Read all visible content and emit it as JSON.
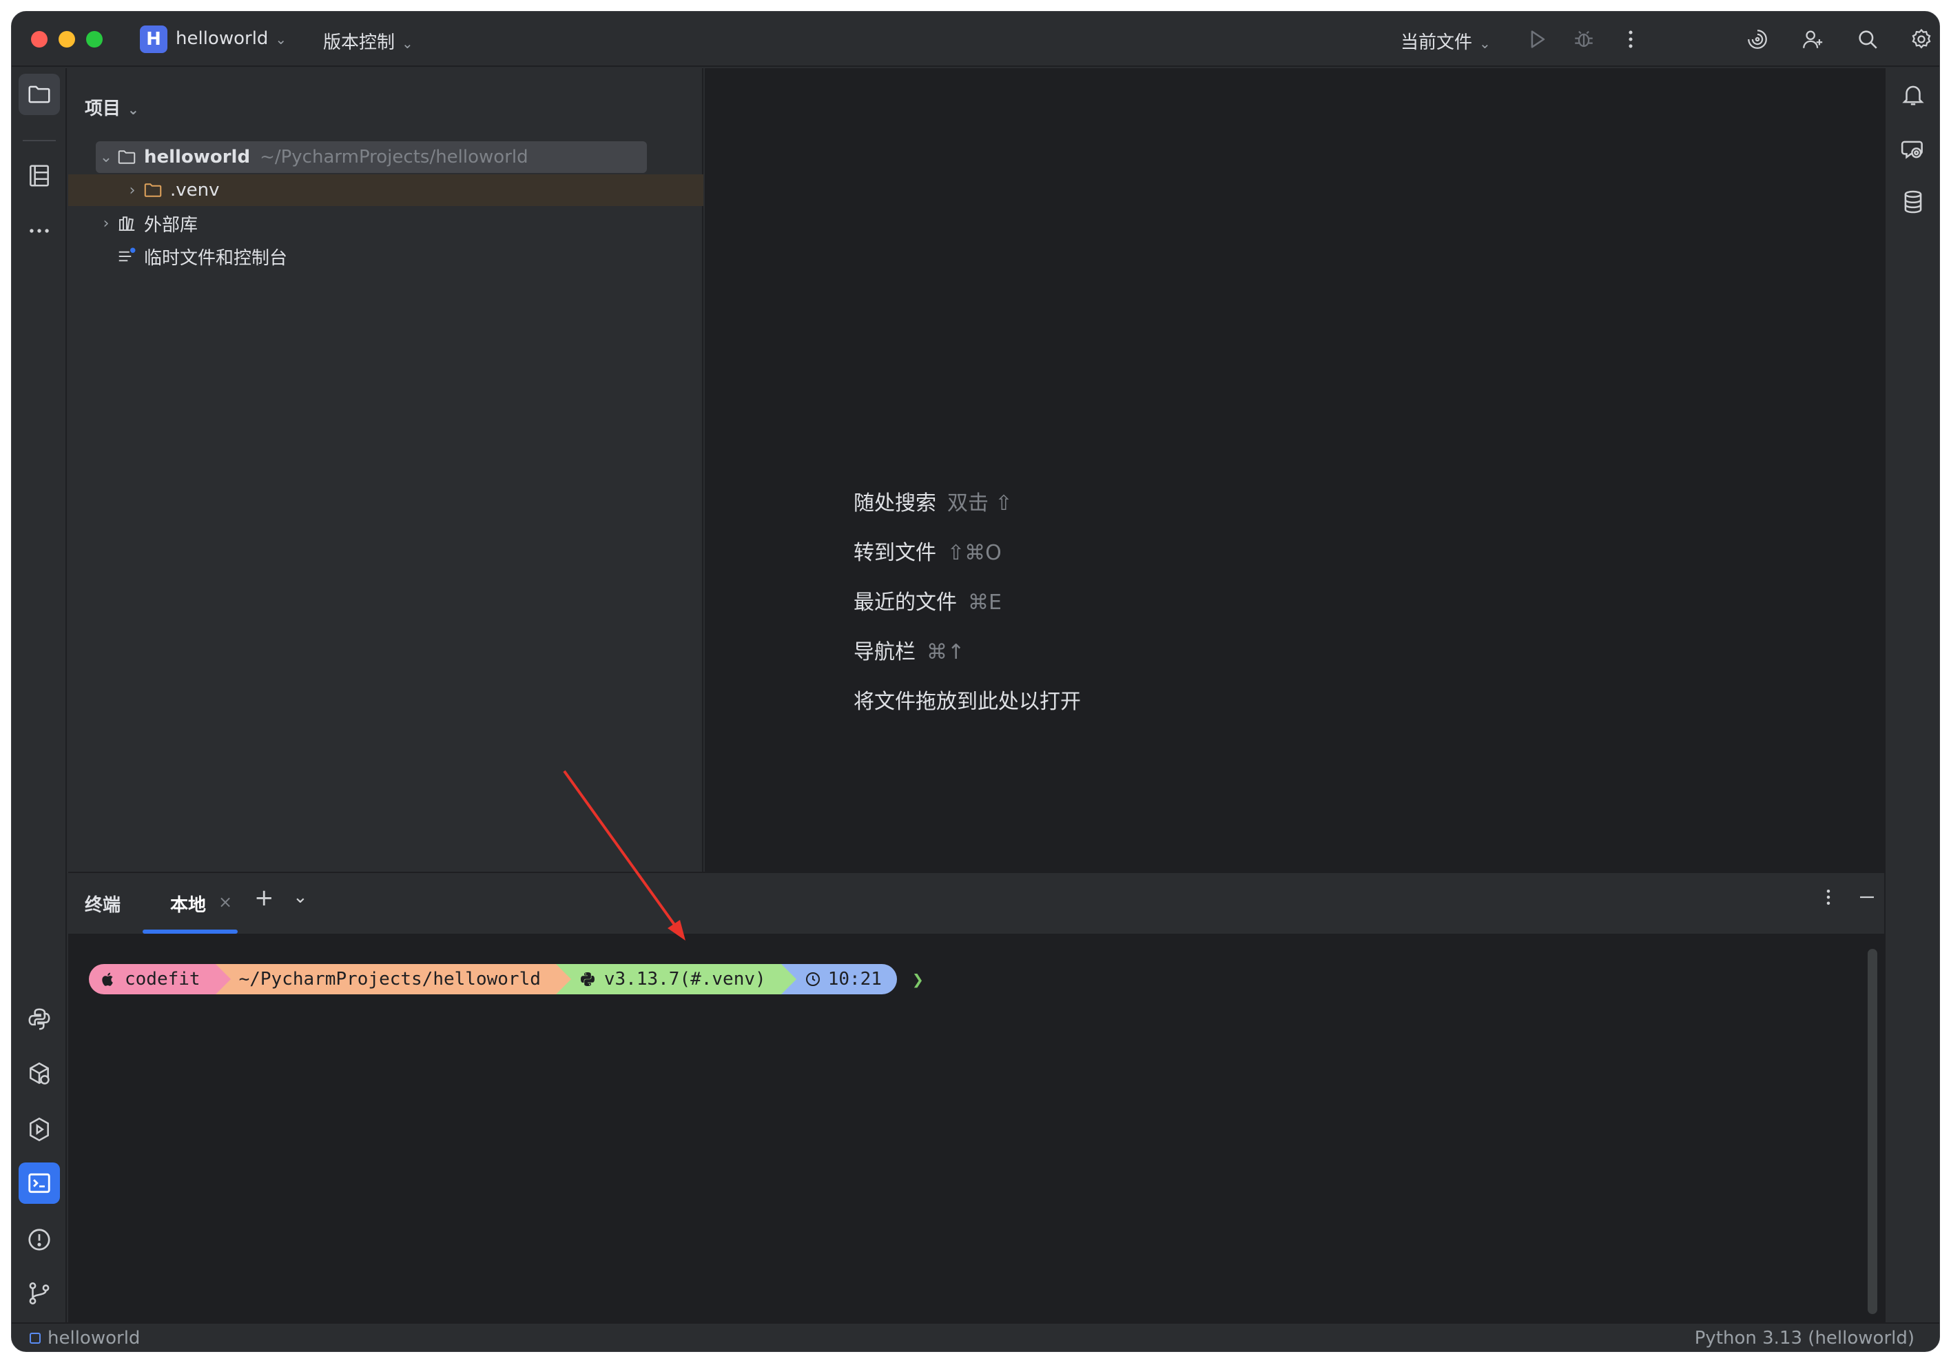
{
  "titlebar": {
    "project_initial": "H",
    "project_name": "helloworld",
    "vcs_label": "版本控制",
    "run_config": "当前文件"
  },
  "project_panel": {
    "title": "项目",
    "tree": [
      {
        "label": "helloworld",
        "path": "~/PycharmProjects/helloworld",
        "expanded": true
      },
      {
        "label": ".venv",
        "expanded": false
      },
      {
        "label": "外部库",
        "expanded": false
      },
      {
        "label": "临时文件和控制台"
      }
    ]
  },
  "editor_hints": [
    {
      "label": "随处搜索",
      "shortcut": "双击 ⇧"
    },
    {
      "label": "转到文件",
      "shortcut": "⇧⌘O"
    },
    {
      "label": "最近的文件",
      "shortcut": "⌘E"
    },
    {
      "label": "导航栏",
      "shortcut": "⌘↑"
    },
    {
      "label": "将文件拖放到此处以打开",
      "shortcut": ""
    }
  ],
  "terminal": {
    "title": "终端",
    "tab_label": "本地",
    "prompt": {
      "user": "codefit",
      "path": "~/PycharmProjects/helloworld",
      "python": "v3.13.7(#.venv)",
      "time": "10:21",
      "symbol": "❯"
    }
  },
  "statusbar": {
    "project": "helloworld",
    "interpreter": "Python 3.13 (helloworld)"
  },
  "colors": {
    "accent": "#3574f0",
    "arrow": "#e8332a",
    "seg_user": "#f48fb1",
    "seg_path": "#f7b58a",
    "seg_python": "#a5e38d",
    "seg_time": "#94b4f2"
  }
}
